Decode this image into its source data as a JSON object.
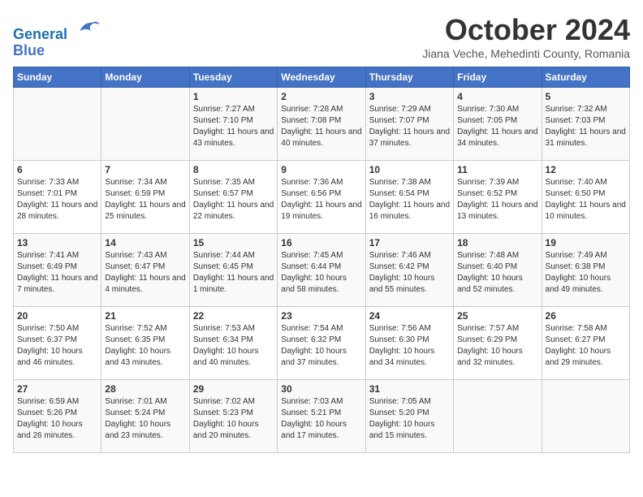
{
  "logo": {
    "line1": "General",
    "line2": "Blue"
  },
  "title": "October 2024",
  "location": "Jiana Veche, Mehedinti County, Romania",
  "days_of_week": [
    "Sunday",
    "Monday",
    "Tuesday",
    "Wednesday",
    "Thursday",
    "Friday",
    "Saturday"
  ],
  "weeks": [
    [
      {
        "day": "",
        "info": ""
      },
      {
        "day": "",
        "info": ""
      },
      {
        "day": "1",
        "info": "Sunrise: 7:27 AM\nSunset: 7:10 PM\nDaylight: 11 hours and 43 minutes."
      },
      {
        "day": "2",
        "info": "Sunrise: 7:28 AM\nSunset: 7:08 PM\nDaylight: 11 hours and 40 minutes."
      },
      {
        "day": "3",
        "info": "Sunrise: 7:29 AM\nSunset: 7:07 PM\nDaylight: 11 hours and 37 minutes."
      },
      {
        "day": "4",
        "info": "Sunrise: 7:30 AM\nSunset: 7:05 PM\nDaylight: 11 hours and 34 minutes."
      },
      {
        "day": "5",
        "info": "Sunrise: 7:32 AM\nSunset: 7:03 PM\nDaylight: 11 hours and 31 minutes."
      }
    ],
    [
      {
        "day": "6",
        "info": "Sunrise: 7:33 AM\nSunset: 7:01 PM\nDaylight: 11 hours and 28 minutes."
      },
      {
        "day": "7",
        "info": "Sunrise: 7:34 AM\nSunset: 6:59 PM\nDaylight: 11 hours and 25 minutes."
      },
      {
        "day": "8",
        "info": "Sunrise: 7:35 AM\nSunset: 6:57 PM\nDaylight: 11 hours and 22 minutes."
      },
      {
        "day": "9",
        "info": "Sunrise: 7:36 AM\nSunset: 6:56 PM\nDaylight: 11 hours and 19 minutes."
      },
      {
        "day": "10",
        "info": "Sunrise: 7:38 AM\nSunset: 6:54 PM\nDaylight: 11 hours and 16 minutes."
      },
      {
        "day": "11",
        "info": "Sunrise: 7:39 AM\nSunset: 6:52 PM\nDaylight: 11 hours and 13 minutes."
      },
      {
        "day": "12",
        "info": "Sunrise: 7:40 AM\nSunset: 6:50 PM\nDaylight: 11 hours and 10 minutes."
      }
    ],
    [
      {
        "day": "13",
        "info": "Sunrise: 7:41 AM\nSunset: 6:49 PM\nDaylight: 11 hours and 7 minutes."
      },
      {
        "day": "14",
        "info": "Sunrise: 7:43 AM\nSunset: 6:47 PM\nDaylight: 11 hours and 4 minutes."
      },
      {
        "day": "15",
        "info": "Sunrise: 7:44 AM\nSunset: 6:45 PM\nDaylight: 11 hours and 1 minute."
      },
      {
        "day": "16",
        "info": "Sunrise: 7:45 AM\nSunset: 6:44 PM\nDaylight: 10 hours and 58 minutes."
      },
      {
        "day": "17",
        "info": "Sunrise: 7:46 AM\nSunset: 6:42 PM\nDaylight: 10 hours and 55 minutes."
      },
      {
        "day": "18",
        "info": "Sunrise: 7:48 AM\nSunset: 6:40 PM\nDaylight: 10 hours and 52 minutes."
      },
      {
        "day": "19",
        "info": "Sunrise: 7:49 AM\nSunset: 6:38 PM\nDaylight: 10 hours and 49 minutes."
      }
    ],
    [
      {
        "day": "20",
        "info": "Sunrise: 7:50 AM\nSunset: 6:37 PM\nDaylight: 10 hours and 46 minutes."
      },
      {
        "day": "21",
        "info": "Sunrise: 7:52 AM\nSunset: 6:35 PM\nDaylight: 10 hours and 43 minutes."
      },
      {
        "day": "22",
        "info": "Sunrise: 7:53 AM\nSunset: 6:34 PM\nDaylight: 10 hours and 40 minutes."
      },
      {
        "day": "23",
        "info": "Sunrise: 7:54 AM\nSunset: 6:32 PM\nDaylight: 10 hours and 37 minutes."
      },
      {
        "day": "24",
        "info": "Sunrise: 7:56 AM\nSunset: 6:30 PM\nDaylight: 10 hours and 34 minutes."
      },
      {
        "day": "25",
        "info": "Sunrise: 7:57 AM\nSunset: 6:29 PM\nDaylight: 10 hours and 32 minutes."
      },
      {
        "day": "26",
        "info": "Sunrise: 7:58 AM\nSunset: 6:27 PM\nDaylight: 10 hours and 29 minutes."
      }
    ],
    [
      {
        "day": "27",
        "info": "Sunrise: 6:59 AM\nSunset: 5:26 PM\nDaylight: 10 hours and 26 minutes."
      },
      {
        "day": "28",
        "info": "Sunrise: 7:01 AM\nSunset: 5:24 PM\nDaylight: 10 hours and 23 minutes."
      },
      {
        "day": "29",
        "info": "Sunrise: 7:02 AM\nSunset: 5:23 PM\nDaylight: 10 hours and 20 minutes."
      },
      {
        "day": "30",
        "info": "Sunrise: 7:03 AM\nSunset: 5:21 PM\nDaylight: 10 hours and 17 minutes."
      },
      {
        "day": "31",
        "info": "Sunrise: 7:05 AM\nSunset: 5:20 PM\nDaylight: 10 hours and 15 minutes."
      },
      {
        "day": "",
        "info": ""
      },
      {
        "day": "",
        "info": ""
      }
    ]
  ]
}
